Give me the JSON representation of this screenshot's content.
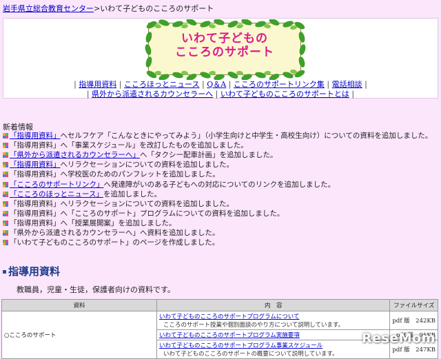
{
  "breadcrumb": {
    "home_link": "岩手県立総合教育センター",
    "separator": ">",
    "current": "いわて子どものこころのサポート"
  },
  "logo": {
    "line1": "いわて子どもの",
    "line2": "こころのサポート",
    "text_color": "#e0198c"
  },
  "nav": {
    "row1": [
      "指導用資料",
      "こころほっとニュース",
      "Q＆A",
      "こころのサポートリンク集",
      "電話相談"
    ],
    "row2": [
      "県外から派遣されるカウンセラーへ",
      "いわて子どものこころのサポートとは"
    ]
  },
  "news": {
    "title": "新着情報",
    "items": [
      {
        "link": "「指導用資料」",
        "text": "へセルフケア「こんなときにやってみよう」（小学生向けと中学生・高校生向け）についての資料を追加しました。"
      },
      {
        "link": "",
        "text": "「指導用資料」へ「事業スケジュール」を改訂したものを追加しました。"
      },
      {
        "link": "「県外から派遣されるカウンセラーへ」",
        "text": "へ「タクシー配車計画」を追加しました。"
      },
      {
        "link": "「指導用資料」",
        "text": "へリラクセーションについての資料を追加しました。"
      },
      {
        "link": "",
        "text": "「指導用資料」へ学校医のためのパンフレットを追加しました。"
      },
      {
        "link": "「こころのサポートリンク」",
        "text": "へ発達障がいのある子どもへの対応についてのリンクを追加しました。"
      },
      {
        "link": "「こころのほっとニュース」",
        "text": "を追加しました。"
      },
      {
        "link": "",
        "text": "「指導用資料」へリラクセーションについての資料を追加しました。"
      },
      {
        "link": "",
        "text": "「指導用資料」へ「こころのサポート」プログラムについての資料を追加しました。"
      },
      {
        "link": "",
        "text": "「指導用資料」へ「授業展開案」を追加しました。"
      },
      {
        "link": "",
        "text": "「県外から派遣されるカウンセラーへ」へ資料を追加しました。"
      },
      {
        "link": "",
        "text": "「いわて子どものこころのサポート」のページを作成しました。"
      }
    ]
  },
  "section": {
    "title": "指導用資料",
    "description": "教職員，児童・生徒，保護者向けの資料です。"
  },
  "table": {
    "headers": [
      "資料",
      "内　容",
      "ファイルサイズ"
    ],
    "rows": [
      {
        "resource": "○こころのサポート",
        "entries": [
          {
            "link": "いわて子どものこころのサポートプログラムについて",
            "desc": "こころのサポート授業や個別面談のやり方について説明しています。",
            "size": "pdf 版　242KB"
          },
          {
            "link": "いわて子どものこころのサポートプログラム実施要項",
            "desc": "",
            "size": "pdf 版　95KB"
          },
          {
            "link": "いわて子どものこころのサポートプログラム事業スケジュール",
            "desc": "いわて子どものこころのサポートの概要について説明しています。",
            "size": "pdf 版　247KB"
          }
        ]
      }
    ]
  },
  "watermark": "ReseMom"
}
